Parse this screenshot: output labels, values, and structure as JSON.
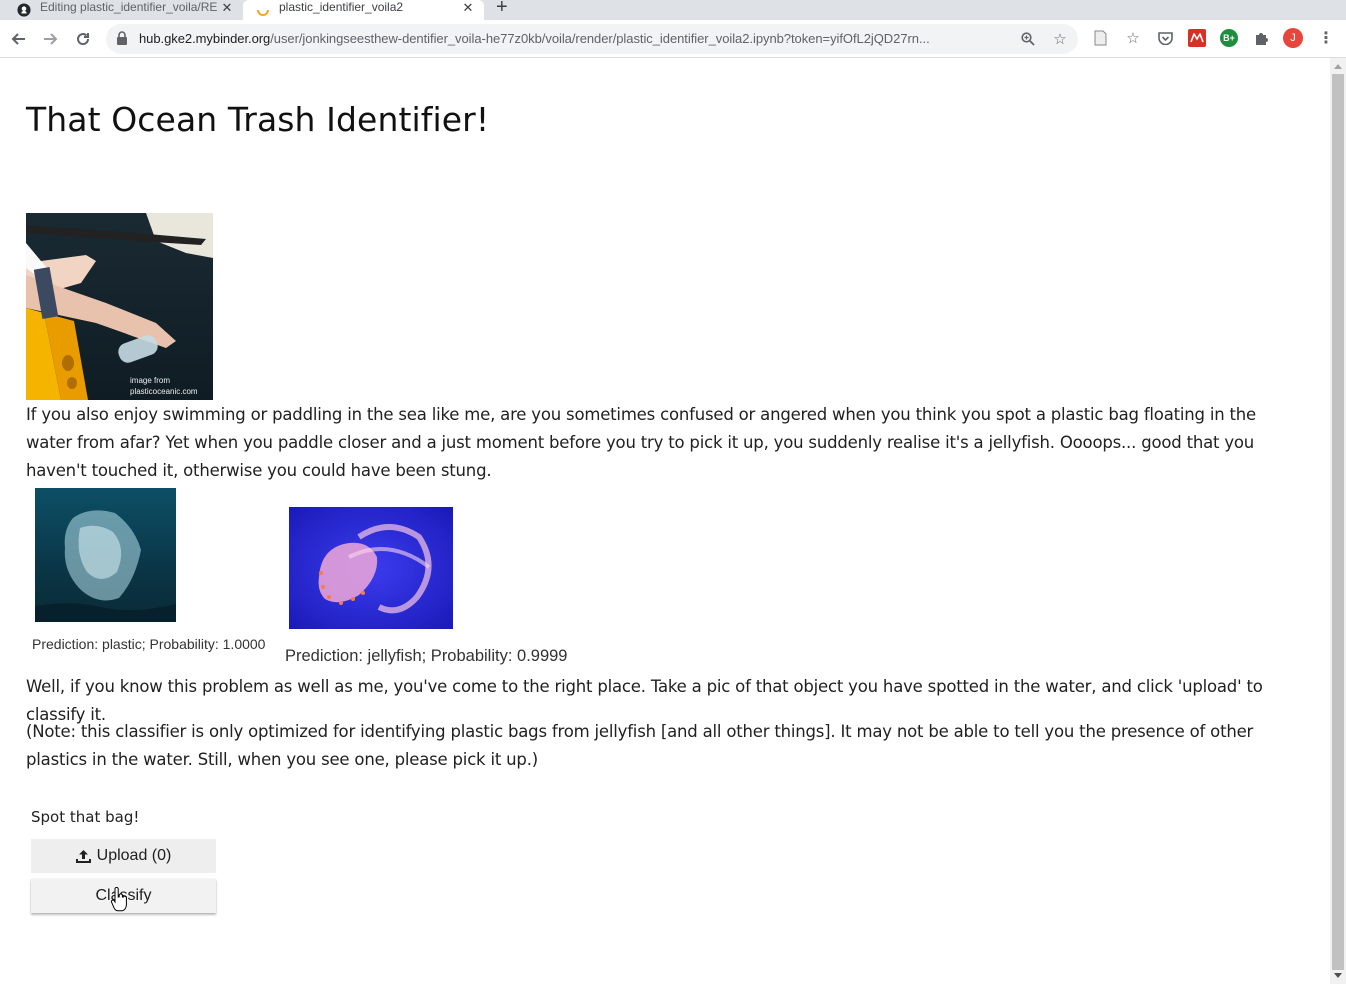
{
  "browser": {
    "tabs": [
      {
        "title": "Editing plastic_identifier_voila/RE",
        "active": false
      },
      {
        "title": "plastic_identifier_voila2",
        "active": true
      }
    ],
    "url": {
      "host": "hub.gke2.mybinder.org",
      "path": "/user/jonkingseesthew-dentifier_voila-he77z0kb/voila/render/plastic_identifier_voila2.ipynb?token=yifOfL2jQD27rn..."
    },
    "profile_initial": "J",
    "extension_badge": "B+"
  },
  "page": {
    "title": "That Ocean Trash Identifier!",
    "hero_credit_line1": "image from",
    "hero_credit_line2": "plasticoceanic.com",
    "intro": "If you also enjoy swimming or paddling in the sea like me, are you sometimes confused or angered when you think you spot a plastic bag floating in the water from afar? Yet when you paddle closer and a just moment before you try to pick it up, you suddenly realise it's a jellyfish. Oooops... good that you haven't touched it, otherwise you could have been stung.",
    "example_plastic_caption": "Prediction: plastic; Probability: 1.0000",
    "example_jellyfish_caption": "Prediction: jellyfish; Probability: 0.9999",
    "instructions": "Well, if you know this problem as well as me, you've come to the right place. Take a pic of that object you have spotted in the water, and click 'upload' to classify it.",
    "note": "(Note: this classifier is only optimized for identifying plastic bags from jellyfish [and all other things]. It may not be able to tell you the presence of other plastics in the water. Still, when you see one, please pick it up.)",
    "widget_label": "Spot that bag!",
    "upload_label": "Upload (0)",
    "classify_label": "Classify"
  }
}
